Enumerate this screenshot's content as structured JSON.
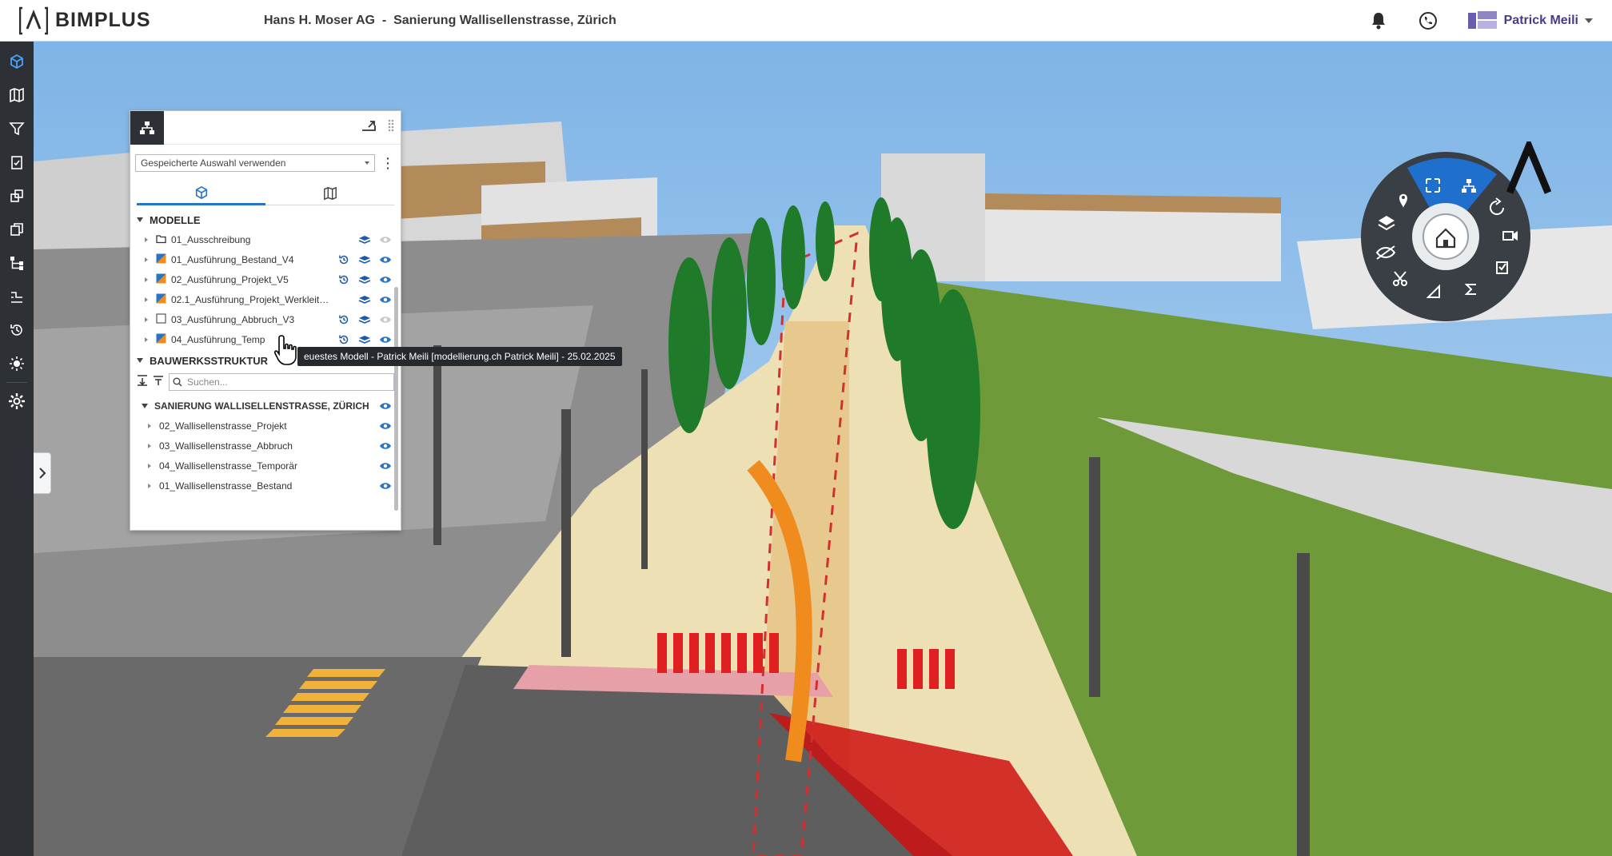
{
  "app": {
    "name": "BIMPLUS",
    "company": "Hans H. Moser AG",
    "separator": "-",
    "project": "Sanierung Wallisellenstrasse, Zürich"
  },
  "user": {
    "name": "Patrick Meili"
  },
  "colors": {
    "accent": "#2a74c6",
    "rail": "#2d3136",
    "user": "#4a3a8c"
  },
  "rail_icons": [
    "cube-icon",
    "map-icon",
    "filter-icon",
    "clipboard-icon",
    "layers-icon",
    "copy-icon",
    "hierarchy-icon",
    "steps-icon",
    "history-icon",
    "sun-icon",
    "gear-icon"
  ],
  "panel": {
    "selection_placeholder": "Gespeicherte Auswahl verwenden",
    "sections": {
      "models": "MODELLE",
      "structure": "BAUWERKSSTRUKTUR"
    },
    "models": [
      {
        "label": "01_Ausschreibung",
        "type": "folder",
        "history": false,
        "visible": false
      },
      {
        "label": "01_Ausführung_Bestand_V4",
        "type": "model",
        "history": true,
        "visible": true
      },
      {
        "label": "02_Ausführung_Projekt_V5",
        "type": "model",
        "history": true,
        "visible": true
      },
      {
        "label": "02.1_Ausführung_Projekt_Werkleitu...",
        "type": "model",
        "history": false,
        "visible": true
      },
      {
        "label": "03_Ausführung_Abbruch_V3",
        "type": "empty",
        "history": true,
        "visible": false
      },
      {
        "label": "04_Ausführung_Temp",
        "type": "model",
        "history": true,
        "visible": true
      }
    ],
    "search_placeholder": "Suchen...",
    "tree_root": "SANIERUNG WALLISELLENSTRASSE, ZÜRICH",
    "tree_items": [
      "02_Wallisellenstrasse_Projekt",
      "03_Wallisellenstrasse_Abbruch",
      "04_Wallisellenstrasse_Temporär",
      "01_Wallisellenstrasse_Bestand"
    ]
  },
  "tooltip": "euestes Modell - Patrick Meili [modellierung.ch Patrick Meili] - 25.02.2025",
  "nav_wheel": {
    "center": "home-icon",
    "segments": [
      "fit-icon",
      "hierarchy-icon",
      "rotate-icon",
      "camera-icon",
      "checklist-icon",
      "sum-icon",
      "measure-icon",
      "cut-icon",
      "hide-icon",
      "layers-icon",
      "pin-icon"
    ]
  }
}
